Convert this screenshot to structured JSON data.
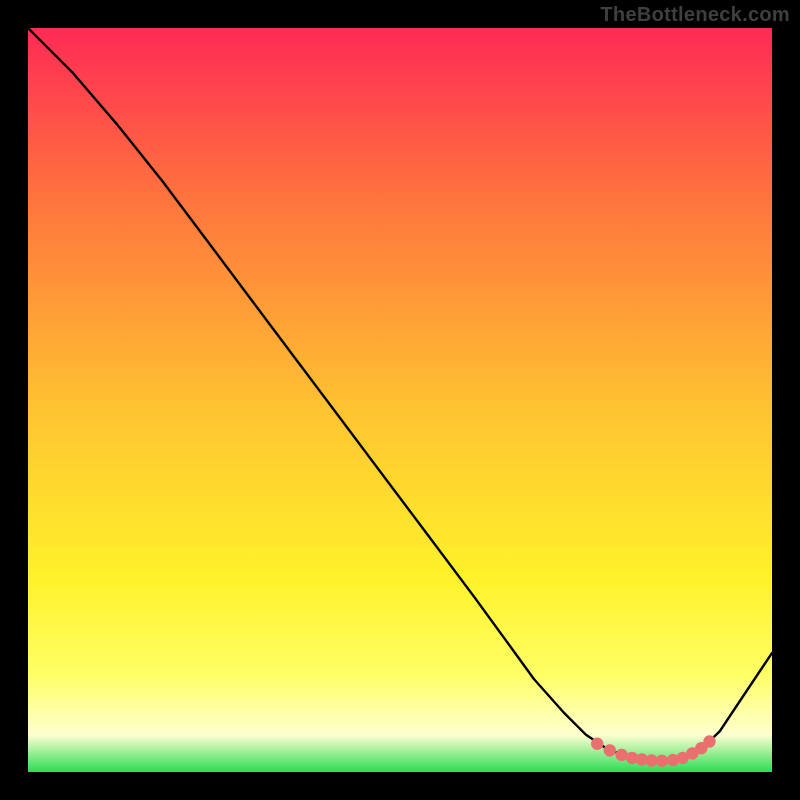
{
  "watermark": "TheBottleneck.com",
  "colors": {
    "page_bg": "#000000",
    "grad_top": "#ff2a55",
    "grad_upper_mid": "#ff7a3c",
    "grad_mid": "#ffc531",
    "grad_lower_mid": "#fff22a",
    "grad_low": "#ffff66",
    "grad_pale": "#ffffd0",
    "grad_green": "#2bdc55",
    "curve_stroke": "#000000",
    "marker_fill": "#e9706f"
  },
  "chart_data": {
    "type": "line",
    "title": "",
    "xlabel": "",
    "ylabel": "",
    "xlim": [
      0,
      100
    ],
    "ylim": [
      0,
      100
    ],
    "x": [
      0,
      6,
      12,
      18,
      24,
      30,
      36,
      42,
      48,
      54,
      60,
      64,
      68,
      72,
      75,
      78,
      81,
      83,
      85,
      87,
      90,
      93,
      96,
      100
    ],
    "values": [
      100,
      94,
      87,
      79.5,
      71.5,
      63.5,
      55.5,
      47.5,
      39.5,
      31.5,
      23.5,
      18,
      12.5,
      8,
      5,
      3,
      2,
      1.6,
      1.5,
      1.6,
      2.6,
      5.5,
      10,
      16
    ],
    "marker_x": [
      76.5,
      78.2,
      79.8,
      81.2,
      82.5,
      83.8,
      85.2,
      86.7,
      88,
      89.3,
      90.5,
      91.6
    ],
    "marker_y": [
      3.8,
      2.9,
      2.3,
      1.9,
      1.7,
      1.55,
      1.5,
      1.6,
      1.9,
      2.5,
      3.2,
      4.1
    ],
    "series": [
      {
        "name": "bottleneck-curve",
        "x_ref": "x",
        "y_ref": "values"
      }
    ]
  }
}
